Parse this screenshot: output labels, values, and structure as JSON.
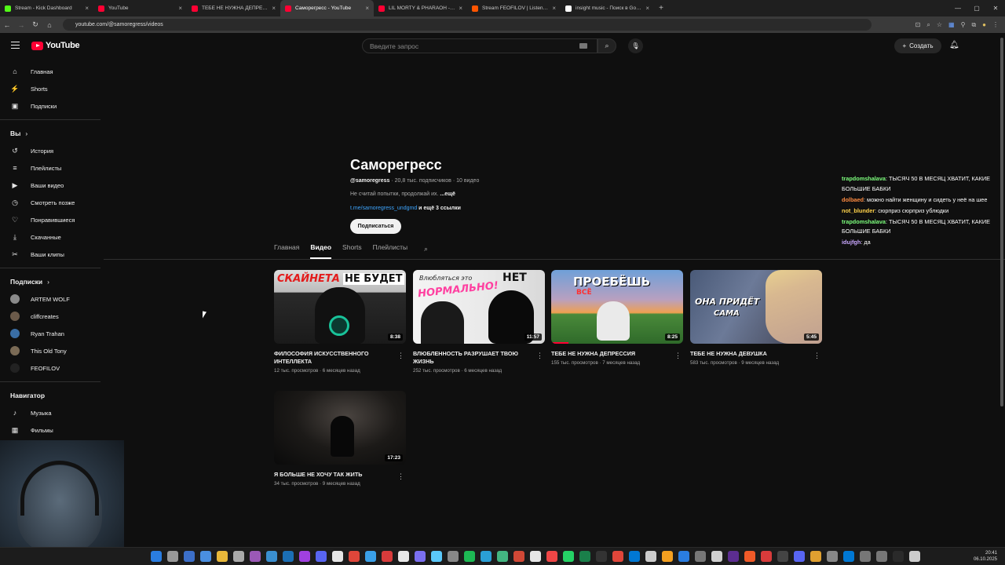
{
  "browser": {
    "tabs": [
      {
        "title": "Stream - Kick Dashboard",
        "color": "#53fc18"
      },
      {
        "title": "YouTube",
        "color": "#ff0033"
      },
      {
        "title": "ТЕБЕ НЕ НУЖНА ДЕПРЕССИЯ",
        "color": "#ff0033"
      },
      {
        "title": "Саморегресс - YouTube",
        "color": "#ff0033"
      },
      {
        "title": "LIL MORTY & PHARAOH - ГЛУБ...",
        "color": "#ff0033"
      },
      {
        "title": "Stream FEOFILOV | Listen to m...",
        "color": "#ff5500"
      },
      {
        "title": "insight music - Поиск в Google",
        "color": "#ffffff"
      }
    ],
    "url": "youtube.com/@samoregress/videos"
  },
  "header": {
    "logo_text": "YouTube",
    "search_placeholder": "Введите запрос",
    "create_label": "Создать"
  },
  "sidebar": {
    "main": [
      {
        "label": "Главная",
        "icon": "home-icon",
        "glyph": "⌂"
      },
      {
        "label": "Shorts",
        "icon": "shorts-icon",
        "glyph": "⚡"
      },
      {
        "label": "Подписки",
        "icon": "subscriptions-icon",
        "glyph": "▣"
      }
    ],
    "you_title": "Вы",
    "you": [
      {
        "label": "История",
        "icon": "history-icon",
        "glyph": "↺"
      },
      {
        "label": "Плейлисты",
        "icon": "playlists-icon",
        "glyph": "≡"
      },
      {
        "label": "Ваши видео",
        "icon": "your-videos-icon",
        "glyph": "▶"
      },
      {
        "label": "Смотреть позже",
        "icon": "watch-later-icon",
        "glyph": "◷"
      },
      {
        "label": "Понравившиеся",
        "icon": "liked-icon",
        "glyph": "♡"
      },
      {
        "label": "Скачанные",
        "icon": "downloads-icon",
        "glyph": "⤓"
      },
      {
        "label": "Ваши клипы",
        "icon": "clips-icon",
        "glyph": "✂"
      }
    ],
    "subs_title": "Подписки",
    "subs": [
      {
        "label": "ARTEM WOLF",
        "color": "#8a8a8a"
      },
      {
        "label": "cliffcreates",
        "color": "#6b5a4a"
      },
      {
        "label": "Ryan Trahan",
        "color": "#3a6ea5"
      },
      {
        "label": "This Old Tony",
        "color": "#7a6a55"
      },
      {
        "label": "FEOFILOV",
        "color": "#222222"
      }
    ],
    "nav_title": "Навигатор",
    "nav": [
      {
        "label": "Музыка",
        "icon": "music-icon",
        "glyph": "♪"
      },
      {
        "label": "Фильмы",
        "icon": "movies-icon",
        "glyph": "▦"
      }
    ]
  },
  "channel": {
    "name": "Саморегресс",
    "handle": "@samoregress",
    "stats": " · 20,8 тыс. подписчиков · 10 видео",
    "description": "Не считай попытки, продолжай их. ",
    "more": "...ещё",
    "link": "t.me/samoregress_undgmd",
    "link_more": " и ещё 3 ссылки",
    "subscribe": "Подписаться",
    "tabs": [
      "Главная",
      "Видео",
      "Shorts",
      "Плейлисты"
    ],
    "active_tab": "Видео"
  },
  "videos": [
    {
      "title": "ФИЛОСОФИЯ ИСКУССТВЕННОГО ИНТЕЛЛЕКТА",
      "meta": "12 тыс. просмотров · 6 месяцев назад",
      "duration": "8:38",
      "thumb_text_1": "СКАЙНЕТА",
      "thumb_text_2": "НЕ БУДЕТ"
    },
    {
      "title": "ВЛЮБЛЕННОСТЬ РАЗРУШАЕТ ТВОЮ ЖИЗНЬ",
      "meta": "252 тыс. просмотров · 6 месяцев назад",
      "duration": "11:57",
      "thumb_text_1": "Влюбляться это",
      "thumb_text_2": "НОРМАЛЬНО!",
      "thumb_text_3": "НЕТ"
    },
    {
      "title": "ТЕБЕ НЕ НУЖНА ДЕПРЕССИЯ",
      "meta": "155 тыс. просмотров · 7 месяцев назад",
      "duration": "8:25",
      "thumb_text_1": "ПРОЕБЁШЬ",
      "thumb_text_2": "ВСЁ"
    },
    {
      "title": "ТЕБЕ НЕ НУЖНА ДЕВУШКА",
      "meta": "583 тыс. просмотров · 9 месяцев назад",
      "duration": "5:45",
      "thumb_text_1": "ОНА ПРИДЁТ",
      "thumb_text_2": "САМА"
    },
    {
      "title": "Я БОЛЬШЕ НЕ ХОЧУ ТАК ЖИТЬ",
      "meta": "34 тыс. просмотров · 9 месяцев назад",
      "duration": "17:23"
    }
  ],
  "chat": [
    {
      "user": "trapdomshalava",
      "text": "ТЫСЯЧ 50 В МЕСЯЦ ХВАТИТ, КАКИЕ БОЛЬШИЕ БАБКИ",
      "color": "#7cfc7c"
    },
    {
      "user": "dolbaed",
      "text": "можно найти женщину и сидеть у неё на шее",
      "color": "#ff8c42"
    },
    {
      "user": "not_blunder",
      "text": "сюрприз сюрприз ублюдки",
      "color": "#ffd24a"
    },
    {
      "user": "trapdomshalava",
      "text": "ТЫСЯЧ 50 В МЕСЯЦ ХВАТИТ, КАКИЕ БОЛЬШИЕ БАБКИ",
      "color": "#7cfc7c"
    },
    {
      "user": "idujfgh",
      "text": "да",
      "color": "#c9a7ff"
    }
  ],
  "taskbar": {
    "time": "20:41",
    "date": "06.10.2025",
    "icon_colors": [
      "#2a7de1",
      "#999",
      "#3c6fc9",
      "#4a8fe0",
      "#e8b83a",
      "#aaa",
      "#9b59b6",
      "#3a8fd0",
      "#1b6fb5",
      "#a040e0",
      "#5865f2",
      "#e6e6e6",
      "#e0463a",
      "#3aa0e8",
      "#d83b3b",
      "#e8e8e8",
      "#7a6ff0",
      "#5ac8fa",
      "#888",
      "#1db954",
      "#2a9fd6",
      "#43b581",
      "#d14836",
      "#e6e6e6",
      "#f04646",
      "#25d366",
      "#1a7f4a",
      "#333",
      "#e0463a",
      "#0078d4",
      "#ccc",
      "#f4a020",
      "#2a7de1",
      "#777",
      "#d0d0d0",
      "#5c2d91",
      "#f05a28",
      "#d83b3b",
      "#444",
      "#5865f2",
      "#e0a030",
      "#888",
      "#0078d4",
      "#777",
      "#777",
      "#2a2a2a",
      "#ccc"
    ]
  }
}
